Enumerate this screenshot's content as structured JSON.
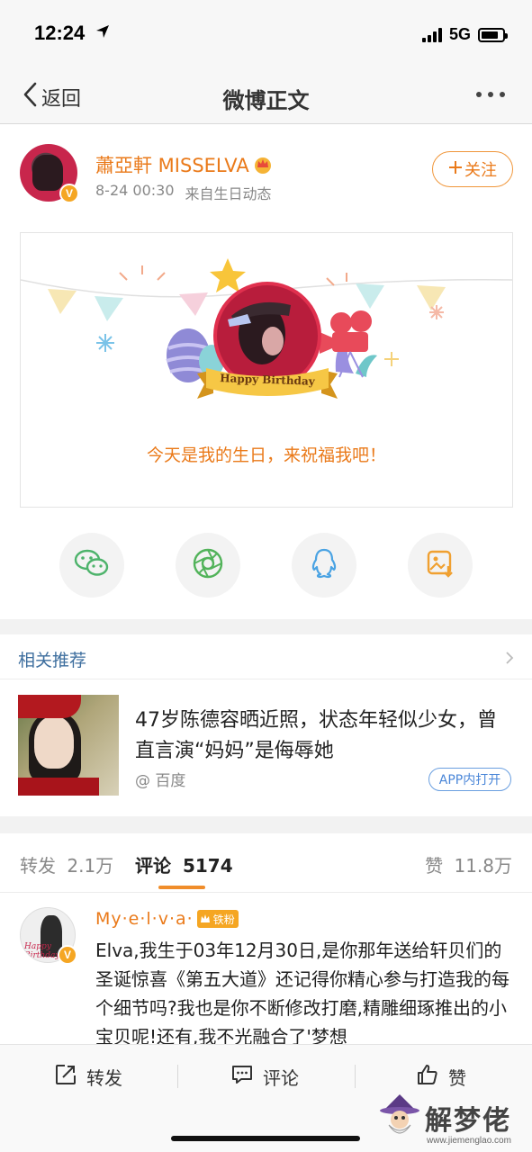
{
  "status_bar": {
    "time": "12:24",
    "network": "5G"
  },
  "nav": {
    "back_label": "返回",
    "title": "微博正文"
  },
  "post": {
    "author": "蕭亞軒 MISSELVA",
    "timestamp": "8-24 00:30",
    "source": "来自生日动态",
    "follow_label": "关注",
    "card": {
      "ribbon": "Happy Birthday",
      "message": "今天是我的生日，来祝福我吧！"
    }
  },
  "related": {
    "section_title": "相关推荐",
    "item": {
      "headline": "47岁陈德容晒近照，状态年轻似少女，曾直言演“妈妈”是侮辱她",
      "source": "@ 百度",
      "app_button": "APP内打开"
    }
  },
  "tabs": {
    "repost_label": "转发",
    "repost_count": "2.1万",
    "comment_label": "评论",
    "comment_count": "5174",
    "like_label": "赞",
    "like_count": "11.8万"
  },
  "comment": {
    "author": "My·e·l·v·a·",
    "badge": "铁粉",
    "text": "Elva,我生于03年12月30日,是你那年送给轩贝们的圣诞惊喜《第五大道》还记得你精心参与打造我的每个细节吗?我也是你不断修改打磨,精雕细琢推出的小宝贝呢!还有,我不光融合了'梦想"
  },
  "bottom_bar": {
    "repost": "转发",
    "comment": "评论",
    "like": "赞"
  },
  "watermark": {
    "text": "解梦佬",
    "url": "www.jiemenglao.com"
  },
  "colors": {
    "accent": "#ea7a1a",
    "link_blue": "#3d6e9e",
    "badge_blue": "#4a86d8"
  }
}
